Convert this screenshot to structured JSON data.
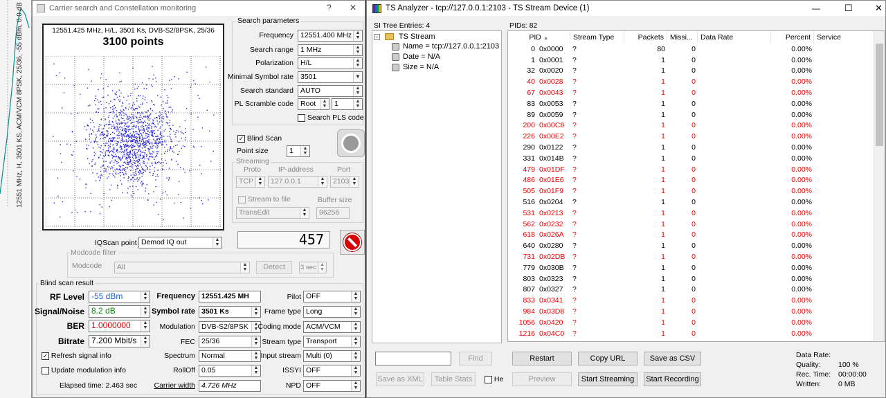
{
  "background": {
    "vertical_text": "12551 MHz, H, 3501 KS, ACM/VCM 8PSK, 25/36, -55 dBm, 0.0 dB"
  },
  "carrier_window": {
    "title": "Carrier search and Constellation monitoring",
    "help": "?",
    "close": "✕",
    "constellation": {
      "info": "12551.425 MHz, H/L, 3501 Ks, DVB-S2/8PSK, 25/36",
      "points_label": "3100 points",
      "point_color": "#2a2ad8"
    },
    "search": {
      "title": "Search parameters",
      "frequency_label": "Frequency",
      "frequency_value": "12551.400 MHz",
      "range_label": "Search range",
      "range_value": "1 MHz",
      "polarization_label": "Polarization",
      "polarization_value": "H/L",
      "min_sr_label": "Minimal Symbol rate",
      "min_sr_value": "3501",
      "standard_label": "Search standard",
      "standard_value": "AUTO",
      "pl_label": "PL Scramble code",
      "pl_mode": "Root",
      "pl_value": "1",
      "search_pls_label": "Search PLS code"
    },
    "blind_scan_label": "Blind Scan",
    "blind_scan_checked": "✓",
    "point_size_label": "Point size",
    "point_size_value": "1",
    "streaming": {
      "title": "Streaming",
      "proto_label": "Proto",
      "ip_label": "IP-address",
      "port_label": "Port",
      "proto_value": "TCP",
      "ip_value": "127.0.0.1",
      "port_value": "2103",
      "stream_to_file_label": "Stream to file",
      "buffer_label": "Buffer size",
      "file_value": "TransEdit",
      "buffer_value": "96256"
    },
    "counter": "457",
    "iqscan_label": "IQScan point",
    "iqscan_value": "Demod IQ out",
    "modcode": {
      "title": "Modcode filter",
      "label": "Modcode",
      "value": "All",
      "detect": "Detect",
      "secs": "3 sec"
    },
    "result": {
      "title": "Blind scan result",
      "rf_label": "RF Level",
      "rf_value": "-55 dBm",
      "sn_label": "Signal/Noise",
      "sn_value": "8.2 dB",
      "ber_label": "BER",
      "ber_value": "1.0000000",
      "bitrate_label": "Bitrate",
      "bitrate_value": "7.200 Mbit/s",
      "freq_label": "Frequency",
      "freq_value": "12551.425 MH",
      "sr_label": "Symbol rate",
      "sr_value": "3501 Ks",
      "mod_label": "Modulation",
      "mod_value": "DVB-S2/8PSK",
      "fec_label": "FEC",
      "fec_value": "25/36",
      "spectrum_label": "Spectrum",
      "spectrum_value": "Normal",
      "rolloff_label": "RollOff",
      "rolloff_value": "0.05",
      "cw_label": "Carrier width",
      "cw_value": "4.726 MHz",
      "pilot_label": "Pilot",
      "pilot_value": "OFF",
      "frame_label": "Frame type",
      "frame_value": "Long",
      "coding_label": "Coding mode",
      "coding_value": "ACM/VCM",
      "stype_label": "Stream type",
      "stype_value": "Transport",
      "istream_label": "Input stream",
      "istream_value": "Multi (0)",
      "issyi_label": "ISSYI",
      "issyi_value": "OFF",
      "npd_label": "NPD",
      "npd_value": "OFF",
      "refresh_label": "Refresh signal info",
      "refresh_checked": "✓",
      "update_mod_label": "Update modulation info",
      "elapsed": "Elapsed time: 2.463 sec"
    }
  },
  "ts_window": {
    "title": "TS Analyzer - tcp://127.0.0.1:2103 - TS Stream Device (1)",
    "minimize": "—",
    "maximize": "☐",
    "close": "✕",
    "si_label": "SI Tree Entries: 4",
    "tree": {
      "root": "TS Stream",
      "items": [
        "Name = tcp://127.0.0.1:2103",
        "Date = N/A",
        "Size = N/A"
      ]
    },
    "pids_label": "PIDs: 82",
    "columns": [
      "PID",
      "Stream Type",
      "Packets",
      "Missi...",
      "Data Rate",
      "Percent",
      "Service"
    ],
    "rows": [
      {
        "d": "0",
        "h": "0x0000",
        "t": "?",
        "p": "80",
        "m": "0",
        "pc": "0.00%",
        "red": false
      },
      {
        "d": "1",
        "h": "0x0001",
        "t": "?",
        "p": "1",
        "m": "0",
        "pc": "0.00%",
        "red": false
      },
      {
        "d": "32",
        "h": "0x0020",
        "t": "?",
        "p": "1",
        "m": "0",
        "pc": "0.00%",
        "red": false
      },
      {
        "d": "40",
        "h": "0x0028",
        "t": "?",
        "p": "1",
        "m": "0",
        "pc": "0.00%",
        "red": true
      },
      {
        "d": "67",
        "h": "0x0043",
        "t": "?",
        "p": "1",
        "m": "0",
        "pc": "0.00%",
        "red": true
      },
      {
        "d": "83",
        "h": "0x0053",
        "t": "?",
        "p": "1",
        "m": "0",
        "pc": "0.00%",
        "red": false
      },
      {
        "d": "89",
        "h": "0x0059",
        "t": "?",
        "p": "1",
        "m": "0",
        "pc": "0.00%",
        "red": false
      },
      {
        "d": "200",
        "h": "0x00C8",
        "t": "?",
        "p": "1",
        "m": "0",
        "pc": "0.00%",
        "red": true
      },
      {
        "d": "226",
        "h": "0x00E2",
        "t": "?",
        "p": "1",
        "m": "0",
        "pc": "0.00%",
        "red": true
      },
      {
        "d": "290",
        "h": "0x0122",
        "t": "?",
        "p": "1",
        "m": "0",
        "pc": "0.00%",
        "red": false
      },
      {
        "d": "331",
        "h": "0x014B",
        "t": "?",
        "p": "1",
        "m": "0",
        "pc": "0.00%",
        "red": false
      },
      {
        "d": "479",
        "h": "0x01DF",
        "t": "?",
        "p": "1",
        "m": "0",
        "pc": "0.00%",
        "red": true
      },
      {
        "d": "486",
        "h": "0x01E6",
        "t": "?",
        "p": "1",
        "m": "0",
        "pc": "0.00%",
        "red": true
      },
      {
        "d": "505",
        "h": "0x01F9",
        "t": "?",
        "p": "1",
        "m": "0",
        "pc": "0.00%",
        "red": true
      },
      {
        "d": "516",
        "h": "0x0204",
        "t": "?",
        "p": "1",
        "m": "0",
        "pc": "0.00%",
        "red": false
      },
      {
        "d": "531",
        "h": "0x0213",
        "t": "?",
        "p": "1",
        "m": "0",
        "pc": "0.00%",
        "red": true
      },
      {
        "d": "562",
        "h": "0x0232",
        "t": "?",
        "p": "1",
        "m": "0",
        "pc": "0.00%",
        "red": true
      },
      {
        "d": "618",
        "h": "0x026A",
        "t": "?",
        "p": "1",
        "m": "0",
        "pc": "0.00%",
        "red": true
      },
      {
        "d": "640",
        "h": "0x0280",
        "t": "?",
        "p": "1",
        "m": "0",
        "pc": "0.00%",
        "red": false
      },
      {
        "d": "731",
        "h": "0x02DB",
        "t": "?",
        "p": "1",
        "m": "0",
        "pc": "0.00%",
        "red": true
      },
      {
        "d": "779",
        "h": "0x030B",
        "t": "?",
        "p": "1",
        "m": "0",
        "pc": "0.00%",
        "red": false
      },
      {
        "d": "803",
        "h": "0x0323",
        "t": "?",
        "p": "1",
        "m": "0",
        "pc": "0.00%",
        "red": false
      },
      {
        "d": "807",
        "h": "0x0327",
        "t": "?",
        "p": "1",
        "m": "0",
        "pc": "0.00%",
        "red": false
      },
      {
        "d": "833",
        "h": "0x0341",
        "t": "?",
        "p": "1",
        "m": "0",
        "pc": "0.00%",
        "red": true
      },
      {
        "d": "984",
        "h": "0x03D8",
        "t": "?",
        "p": "1",
        "m": "0",
        "pc": "0.00%",
        "red": true
      },
      {
        "d": "1056",
        "h": "0x0420",
        "t": "?",
        "p": "1",
        "m": "0",
        "pc": "0.00%",
        "red": true
      },
      {
        "d": "1216",
        "h": "0x04C0",
        "t": "?",
        "p": "1",
        "m": "0",
        "pc": "0.00%",
        "red": true
      }
    ],
    "find": "Find",
    "save_xml": "Save as XML",
    "table_stats": "Table Stats",
    "hex_label": "He",
    "restart": "Restart",
    "copy_url": "Copy URL",
    "save_csv": "Save as CSV",
    "preview": "Preview",
    "start_streaming": "Start Streaming",
    "start_recording": "Start Recording",
    "stats": {
      "data_rate": "Data Rate:",
      "quality_label": "Quality:",
      "quality": "100 %",
      "rec_label": "Rec. Time:",
      "rec": "00:00:00",
      "written_label": "Written:",
      "written": "0 MB"
    }
  }
}
